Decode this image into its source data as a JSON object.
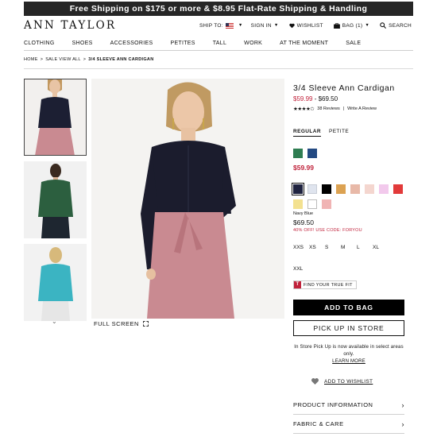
{
  "promo_bar": "Free Shipping on $175 or more & $8.95 Flat-Rate Shipping & Handling",
  "logo": "ANN TAYLOR",
  "utility": {
    "ship_to": "SHIP TO:",
    "sign_in": "SIGN IN",
    "wishlist": "WISHLIST",
    "bag": "BAG (1)",
    "search": "SEARCH"
  },
  "nav": [
    "CLOTHING",
    "SHOES",
    "ACCESSORIES",
    "PETITES",
    "TALL",
    "WORK",
    "AT THE MOMENT",
    "SALE"
  ],
  "breadcrumb": {
    "home": "HOME",
    "sale": "SALE VIEW ALL",
    "current": "3/4 SLEEVE ANN CARDIGAN",
    "separator": ">"
  },
  "gallery": {
    "full_screen": "FULL SCREEN",
    "thumb_colors": [
      "#1c1f33",
      "#2c5f3f",
      "#3bb4c2"
    ]
  },
  "product": {
    "title": "3/4 Sleeve Ann Cardigan",
    "price_sale": "$59.99",
    "price_sep": " - ",
    "price_high": "$69.50",
    "stars": "★★★★✩",
    "reviews": "38 Reviews",
    "pipe": "|",
    "write_review": "Write A Review",
    "fits": [
      "REGULAR",
      "PETITE"
    ],
    "selected_fit": "REGULAR",
    "sale_swatches": [
      "#2f7d52",
      "#234a82"
    ],
    "sale_price": "$59.99",
    "regular_swatches": [
      "#1f2340",
      "#dfe4ee",
      "#000000",
      "#dca252",
      "#e8b9a8",
      "#f4d6cf",
      "#f2c9ec",
      "#e23a3a",
      "#f3e190",
      "#ffffff",
      "#f0b4b4"
    ],
    "selected_color": "Navy Blue",
    "regular_price": "$69.50",
    "promo_code": "40% OFF! USE CODE: FORYOU",
    "sizes": [
      "XXS",
      "XS",
      "S",
      "M",
      "L",
      "XL",
      "XXL"
    ],
    "fit_finder": "FIND YOUR TRUE FIT",
    "fit_finder_logo": "T",
    "add_to_bag": "ADD TO BAG",
    "pick_up": "PICK UP IN STORE",
    "store_note": "In Store Pick Up is now available in select areas only.",
    "learn_more": "LEARN MORE",
    "add_to_wishlist": "ADD TO WISHLIST",
    "accordions": [
      "PRODUCT INFORMATION",
      "FABRIC & CARE"
    ]
  },
  "colors": {
    "sale_red": "#c0223b",
    "promo_bg": "#262626"
  }
}
